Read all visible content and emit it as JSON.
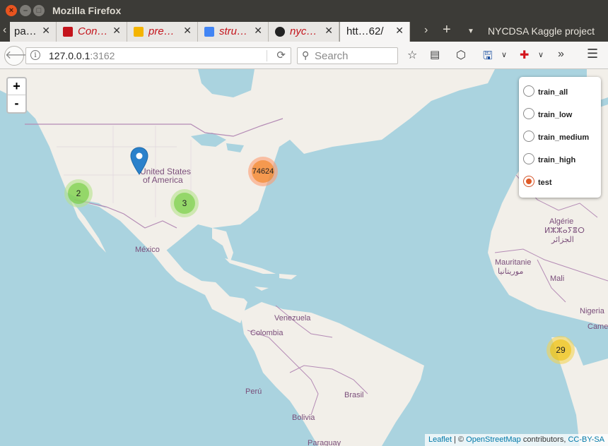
{
  "window": {
    "title": "Mozilla Firefox"
  },
  "tabs": [
    {
      "label": "pa…",
      "favicon_color": "#6a6a6a",
      "style": "plain"
    },
    {
      "label": "Con…",
      "favicon_color": "#c4141c",
      "style": "italic"
    },
    {
      "label": "pre…",
      "favicon_color": "#f4b400",
      "style": "italic"
    },
    {
      "label": "stru…",
      "favicon_color": "#4285f4",
      "style": "italic"
    },
    {
      "label": "nyc…",
      "favicon_color": "#222222",
      "style": "italic"
    },
    {
      "label": "htt…62/",
      "favicon_color": "",
      "style": "active"
    }
  ],
  "tabstrip": {
    "project_title": "NYCDSA Kaggle project"
  },
  "navbar": {
    "url_host": "127.0.0.1",
    "url_port": ":3162",
    "search_placeholder": "Search"
  },
  "map": {
    "zoom_in": "+",
    "zoom_out": "-",
    "labels": {
      "usa": "United States",
      "usa2": "of America",
      "mexico": "México",
      "venezuela": "Venezuela",
      "colombia": "Colombia",
      "peru": "Perú",
      "brasil": "Brasil",
      "bolivia": "Bolivia",
      "algeria": "Algérie",
      "algeria_tifinagh": "ⵍⵣⵣⴰⵢⴻⵔ",
      "algeria_ar": "الجزائر",
      "mauritanie": "Mauritanie",
      "mauritanie_ar": "موريتانيا",
      "mali": "Mali",
      "nigeria": "Nigeria",
      "cameroun": "Came",
      "paraguay": "Paraguay"
    },
    "clusters": [
      {
        "count": "2",
        "color": "green"
      },
      {
        "count": "3",
        "color": "green"
      },
      {
        "count": "74624",
        "color": "orange"
      },
      {
        "count": "29",
        "color": "yellow"
      }
    ],
    "layers": [
      {
        "label": "train_all",
        "selected": false
      },
      {
        "label": "train_low",
        "selected": false
      },
      {
        "label": "train_medium",
        "selected": false
      },
      {
        "label": "train_high",
        "selected": false
      },
      {
        "label": "test",
        "selected": true
      }
    ],
    "attribution": {
      "leaflet": "Leaflet",
      "separator": " | © ",
      "osm": "OpenStreetMap",
      "contributors": " contributors, ",
      "license": "CC-BY-SA"
    }
  }
}
